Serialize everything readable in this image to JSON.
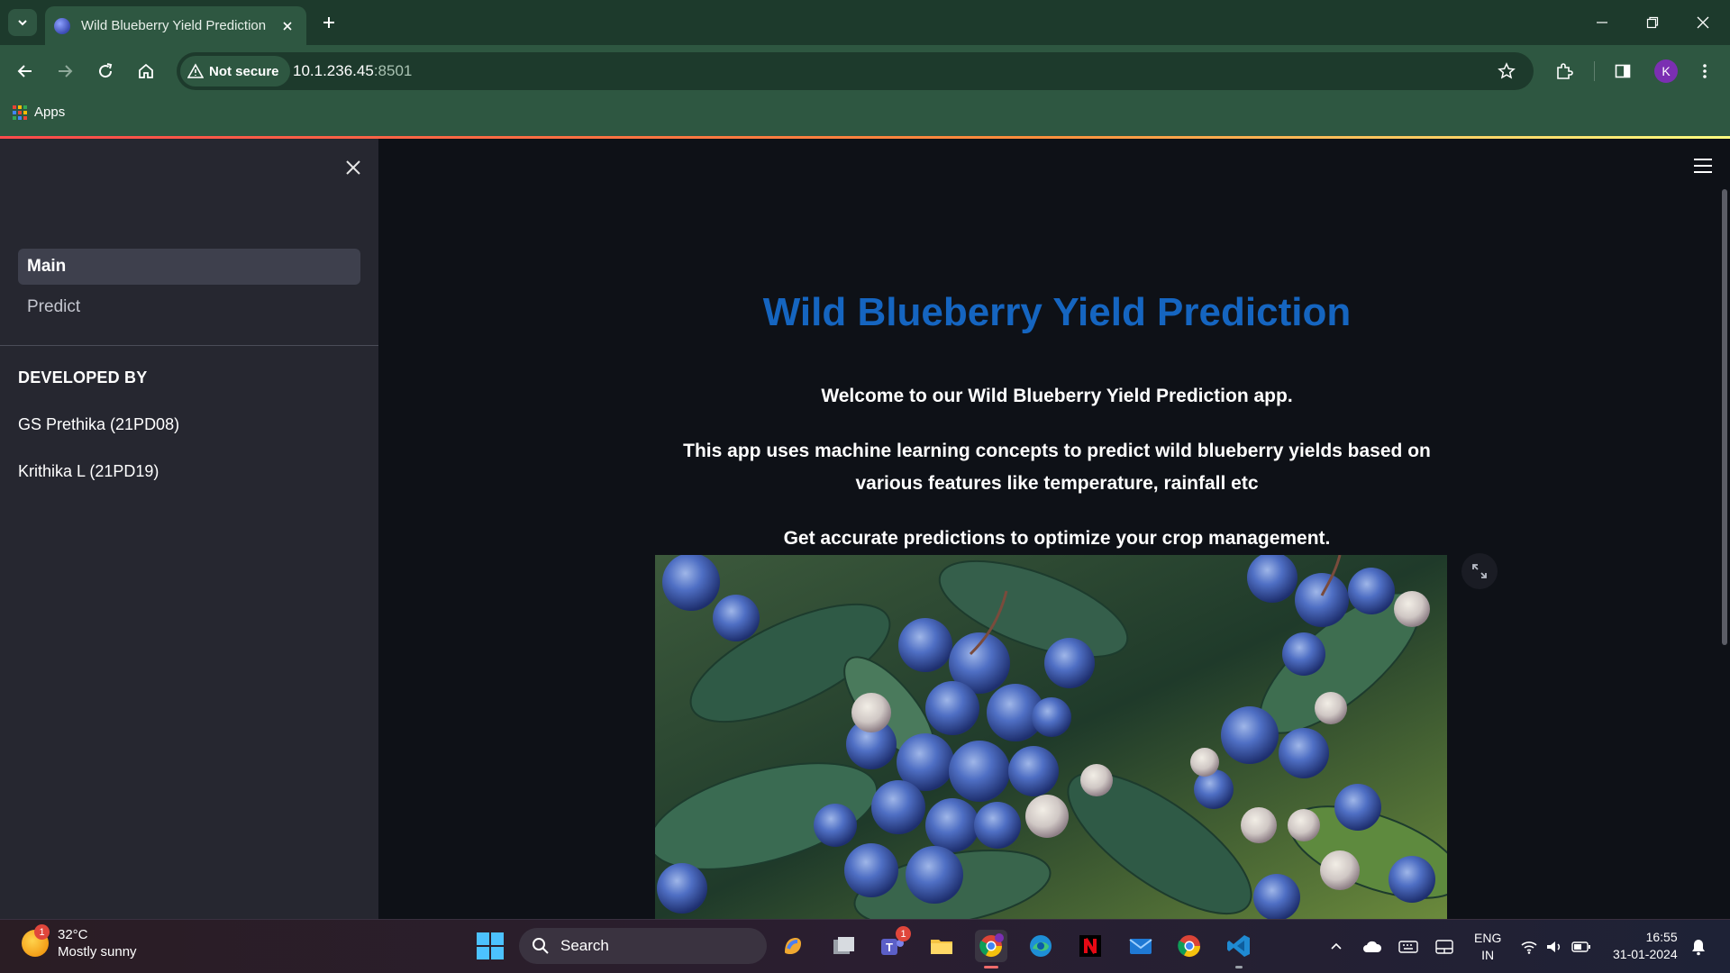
{
  "browser": {
    "tab_title": "Wild Blueberry Yield Prediction",
    "security_label": "Not secure",
    "url_host": "10.1.236.45",
    "url_port": ":8501",
    "bookmark_apps": "Apps",
    "profile_initial": "K"
  },
  "sidebar": {
    "nav": [
      {
        "label": "Main",
        "active": true
      },
      {
        "label": "Predict",
        "active": false
      }
    ],
    "developed_by_heading": "DEVELOPED BY",
    "developers": [
      "GS Prethika (21PD08)",
      "Krithika L (21PD19)"
    ]
  },
  "main": {
    "title": "Wild Blueberry Yield Prediction",
    "welcome": "Welcome to our Wild Blueberry Yield Prediction app.",
    "description": "This app uses machine learning concepts to predict wild blueberry yields based on various features like temperature, rainfall etc",
    "tagline": "Get accurate predictions to optimize your crop management."
  },
  "taskbar": {
    "weather_temp": "32°C",
    "weather_desc": "Mostly sunny",
    "weather_badge": "1",
    "search_label": "Search",
    "teams_badge": "1",
    "lang_line1": "ENG",
    "lang_line2": "IN",
    "time": "16:55",
    "date": "31-01-2024"
  },
  "colors": {
    "title_blue": "#1565c0",
    "chrome_green": "#2e5741",
    "sidebar_bg": "#262730",
    "main_bg": "#0e1117"
  }
}
